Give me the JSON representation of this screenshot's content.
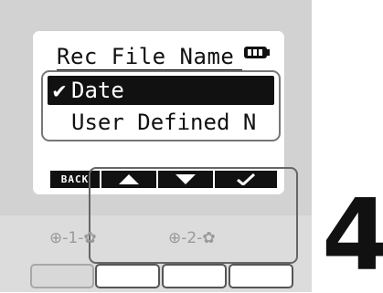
{
  "lcd": {
    "title": "Rec File Name",
    "battery_icon": "battery-full-icon"
  },
  "menu": {
    "items": [
      {
        "label": "Date",
        "selected": true,
        "check": "✔"
      },
      {
        "label": "User Defined N",
        "selected": false,
        "check": ""
      }
    ]
  },
  "softkeys": {
    "back_label": "BACK",
    "up_icon": "triangle-up-icon",
    "down_icon": "triangle-down-icon",
    "ok_icon": "checkmark-icon"
  },
  "gain": {
    "ch1": "⊕-1-✿",
    "ch2": "⊕-2-✿"
  },
  "step": {
    "number": "4"
  },
  "colors": {
    "lcd_fg": "#111111",
    "device_body": "#dcdcdc",
    "callout": "#666666"
  }
}
